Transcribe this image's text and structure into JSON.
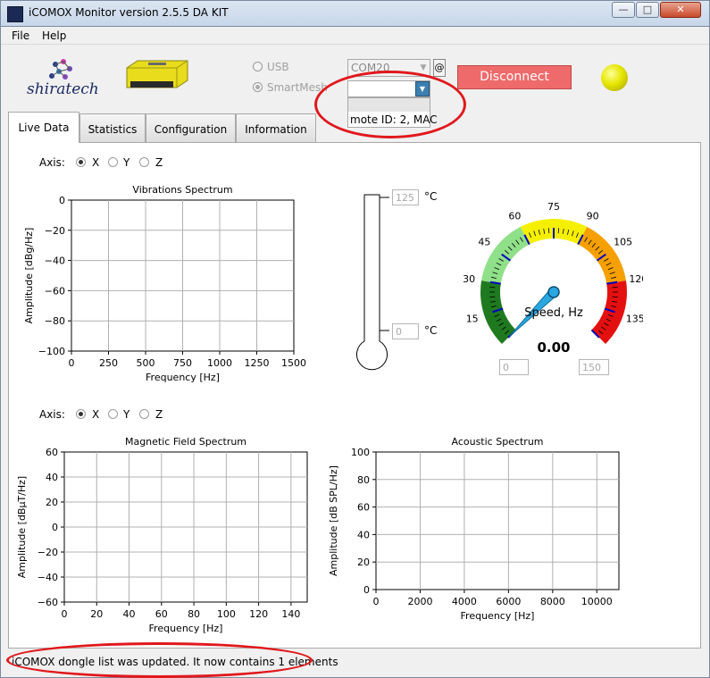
{
  "window": {
    "title": "iCOMOX Monitor version 2.5.5 DA KIT",
    "minimize": "—",
    "maximize": "□",
    "close": "✕"
  },
  "menu": {
    "file": "File",
    "help": "Help"
  },
  "header": {
    "logo_text": "shiratech",
    "usb_label": "USB",
    "smartmesh_label": "SmartMesh",
    "com_port": "COM20",
    "at_label": "@",
    "mote_item": "mote ID: 2, MAC",
    "disconnect_label": "Disconnect",
    "led_color": "#e6e600"
  },
  "tabs": [
    {
      "label": "Live Data",
      "active": true
    },
    {
      "label": "Statistics"
    },
    {
      "label": "Configuration"
    },
    {
      "label": "Information"
    }
  ],
  "axis_selector": {
    "label": "Axis:",
    "options": [
      "X",
      "Y",
      "Z"
    ],
    "selected": "X"
  },
  "thermometer": {
    "max_value": "125",
    "current_value": "0",
    "unit": "°C"
  },
  "gauge": {
    "title": "Speed, Hz",
    "value": "0.00",
    "min_box": "0",
    "max_box": "150",
    "ticks": [
      "15",
      "30",
      "45",
      "60",
      "75",
      "90",
      "105",
      "120",
      "135"
    ],
    "colors": {
      "dark_green": "#1f7a1f",
      "light_green": "#90e08a",
      "yellow": "#f5f000",
      "orange": "#f5a000",
      "red": "#e41010",
      "needle": "#29a7e1"
    }
  },
  "status": {
    "text": "iCOMOX dongle list was updated. It now contains 1 elements"
  },
  "chart_data": [
    {
      "type": "line",
      "title": "Vibrations Spectrum",
      "xlabel": "Frequency [Hz]",
      "ylabel": "Amplitude [dBg/Hz]",
      "xlim": [
        0,
        1500
      ],
      "ylim": [
        -100,
        0
      ],
      "xticks": [
        "0",
        "250",
        "500",
        "750",
        "1000",
        "1250",
        "1500"
      ],
      "yticks": [
        "0",
        "−20",
        "−40",
        "−60",
        "−80",
        "−100"
      ],
      "grid": true,
      "series": []
    },
    {
      "type": "line",
      "title": "Magnetic Field Spectrum",
      "xlabel": "Frequency [Hz]",
      "ylabel": "Amplitude [dBµT/Hz]",
      "xlim": [
        0,
        150
      ],
      "ylim": [
        -60,
        60
      ],
      "xticks": [
        "0",
        "20",
        "40",
        "60",
        "80",
        "100",
        "120",
        "140"
      ],
      "yticks": [
        "60",
        "40",
        "20",
        "0",
        "−20",
        "−40",
        "−60"
      ],
      "grid": true,
      "series": []
    },
    {
      "type": "line",
      "title": "Acoustic Spectrum",
      "xlabel": "Frequency [Hz]",
      "ylabel": "Amplitude [dB SPL/Hz]",
      "xlim": [
        0,
        11000
      ],
      "ylim": [
        0,
        100
      ],
      "xticks": [
        "0",
        "2000",
        "4000",
        "6000",
        "8000",
        "10000"
      ],
      "yticks": [
        "100",
        "80",
        "60",
        "40",
        "20",
        "0"
      ],
      "grid": true,
      "series": []
    }
  ]
}
